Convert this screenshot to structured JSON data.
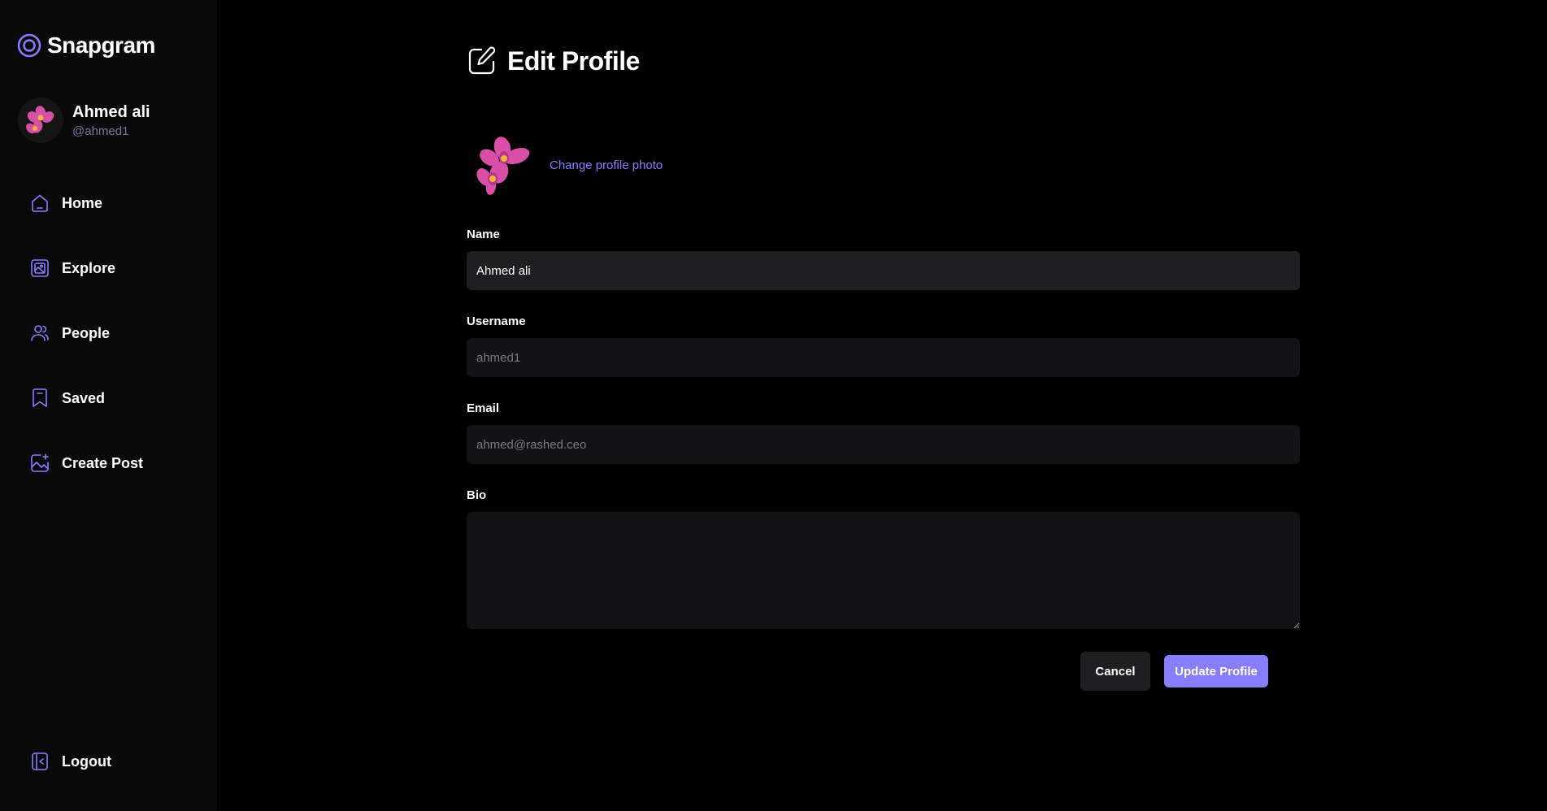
{
  "brand": {
    "name": "Snapgram",
    "accent": "#877eff"
  },
  "user": {
    "name": "Ahmed ali",
    "handle": "@ahmed1"
  },
  "nav": {
    "items": [
      {
        "label": "Home",
        "icon": "home-icon"
      },
      {
        "label": "Explore",
        "icon": "explore-icon"
      },
      {
        "label": "People",
        "icon": "people-icon"
      },
      {
        "label": "Saved",
        "icon": "saved-icon"
      },
      {
        "label": "Create Post",
        "icon": "create-post-icon"
      }
    ],
    "logout": "Logout"
  },
  "page": {
    "title": "Edit Profile"
  },
  "photo": {
    "change_label": "Change profile photo"
  },
  "form": {
    "name_label": "Name",
    "name_value": "Ahmed ali",
    "username_label": "Username",
    "username_value": "ahmed1",
    "email_label": "Email",
    "email_value": "ahmed@rashed.ceo",
    "bio_label": "Bio",
    "bio_value": ""
  },
  "actions": {
    "cancel": "Cancel",
    "update": "Update Profile"
  }
}
